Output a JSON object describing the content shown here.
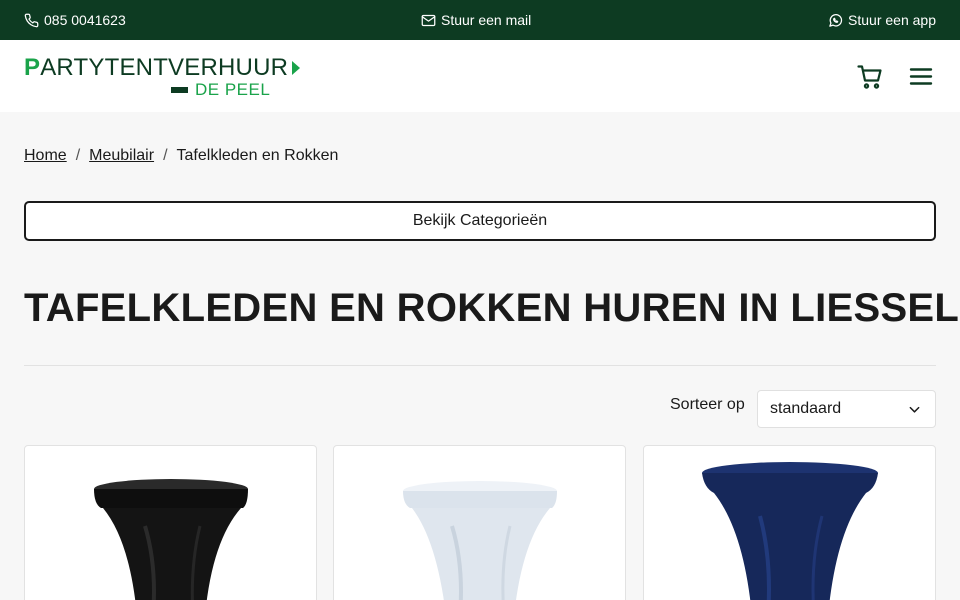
{
  "topbar": {
    "phone": "085 0041623",
    "mail": "Stuur een mail",
    "app": "Stuur een app",
    "icons": [
      "phone-icon",
      "mail-icon",
      "whatsapp-icon"
    ]
  },
  "header": {
    "logo_top_first": "P",
    "logo_top_rest": "ARTYTENTVERHUUR",
    "logo_bottom": "DE PEEL",
    "icons": [
      "cart-icon",
      "menu-icon"
    ]
  },
  "breadcrumb": {
    "items": [
      "Home",
      "Meubilair",
      "Tafelkleden en Rokken"
    ],
    "separator": "/"
  },
  "categories_button": "Bekijk Categorieën",
  "page_title": "TAFELKLEDEN EN ROKKEN HUREN IN LIESSEL",
  "sort": {
    "label": "Sorteer op",
    "value": "standaard"
  },
  "products": [
    {
      "color_name": "zwart",
      "color": "#111111"
    },
    {
      "color_name": "wit",
      "color": "#dfe6ee"
    },
    {
      "color_name": "donkerblauw",
      "color": "#16285a"
    }
  ],
  "colors": {
    "topbar_bg": "#0d3b22",
    "brand_green": "#1aa34a"
  }
}
